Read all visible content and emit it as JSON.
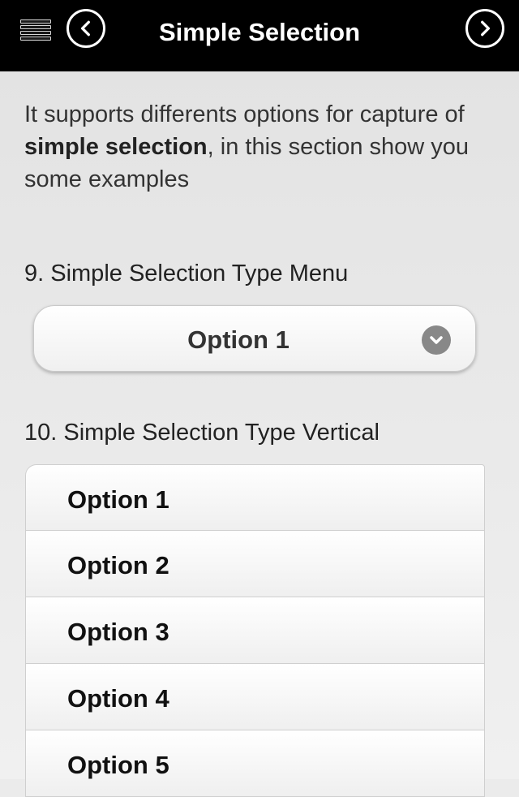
{
  "header": {
    "title": "Simple Selection",
    "menu_icon": "menu-icon",
    "back_icon": "chevron-left-icon",
    "forward_icon": "chevron-right-icon"
  },
  "intro": {
    "text_before": "It supports differents options for capture of ",
    "text_bold": "simple selection",
    "text_after": ", in this section show you some examples"
  },
  "menu_section": {
    "label": "9. Simple Selection Type Menu",
    "selected_value": "Option 1",
    "arrow_icon": "chevron-down-icon"
  },
  "vertical_section": {
    "label": "10. Simple Selection Type Vertical",
    "options": [
      "Option 1",
      "Option 2",
      "Option 3",
      "Option 4",
      "Option 5"
    ]
  },
  "colors": {
    "header_bg": "#000000",
    "content_bg": "#ebebeb",
    "text": "#222222"
  }
}
